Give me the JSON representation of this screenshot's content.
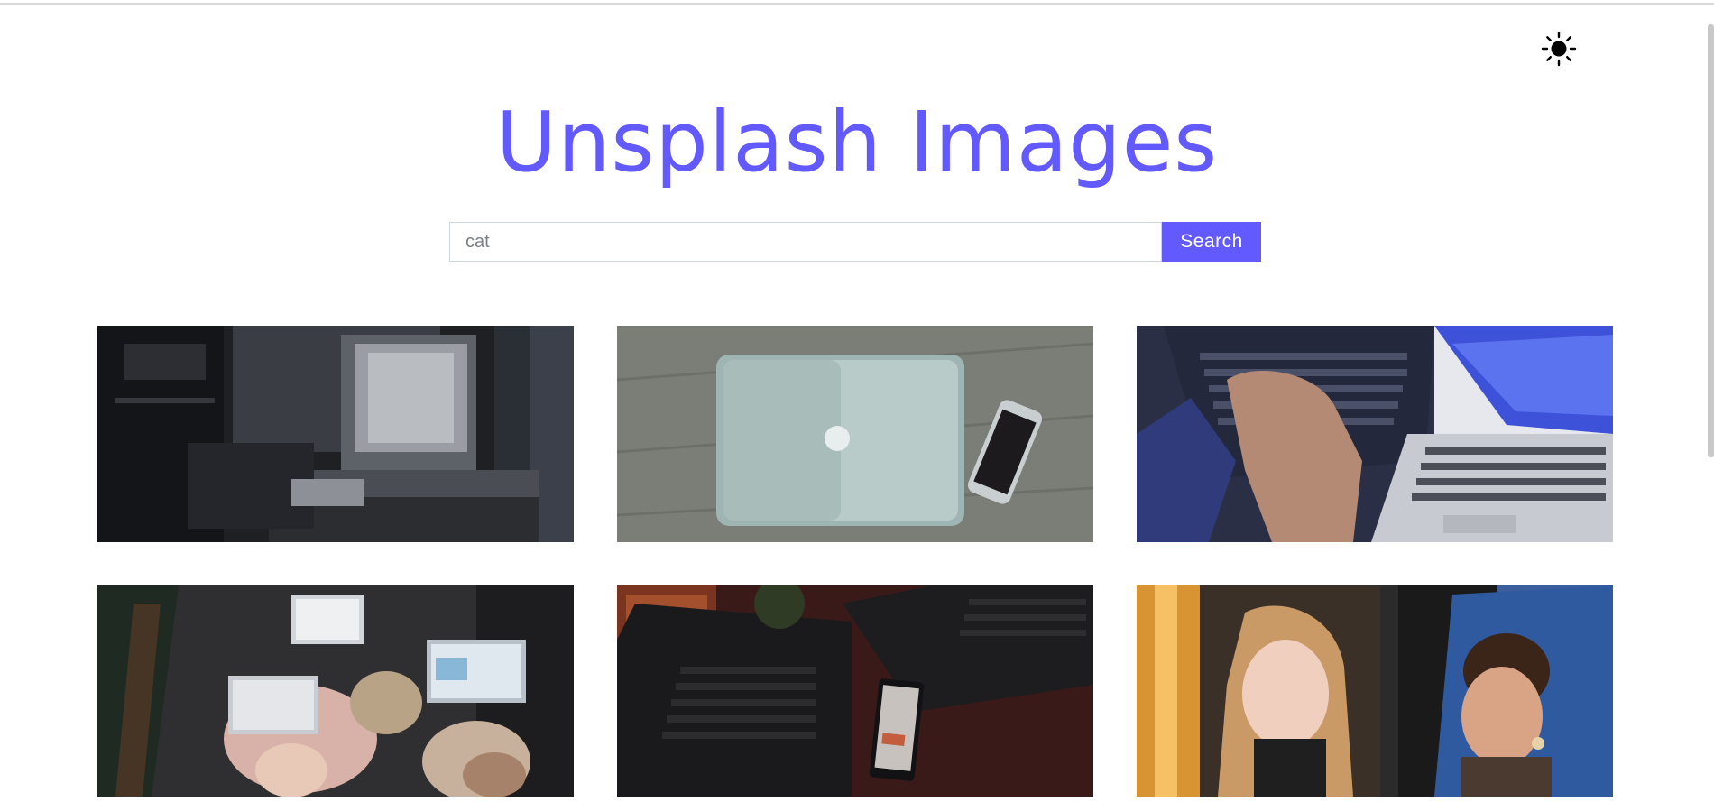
{
  "header": {
    "title": "Unsplash Images",
    "theme_toggle_icon": "sun-icon"
  },
  "search": {
    "placeholder": "cat",
    "value": "",
    "button_label": "Search"
  },
  "gallery": {
    "images": [
      {
        "alt": "dark desk with laptop near window"
      },
      {
        "alt": "silver laptop and phone on bedsheet"
      },
      {
        "alt": "hands typing on laptops"
      },
      {
        "alt": "people lying with laptops top view"
      },
      {
        "alt": "laptops and phone on dark wooden desk"
      },
      {
        "alt": "smiling women looking down"
      }
    ]
  },
  "colors": {
    "accent": "#6259ff",
    "background": "#ffffff"
  }
}
